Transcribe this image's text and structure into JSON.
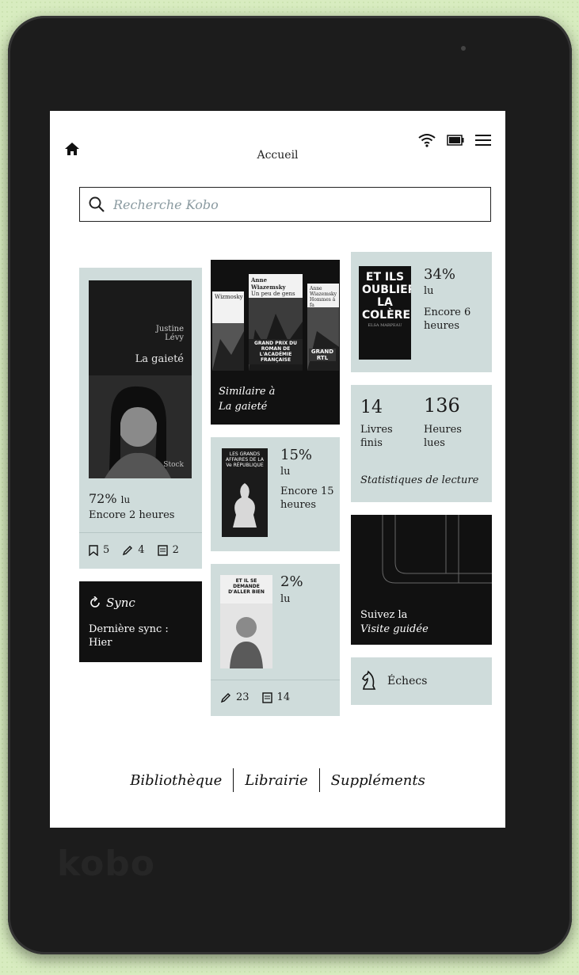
{
  "brand": "kobo",
  "header": {
    "title": "Accueil"
  },
  "search": {
    "placeholder": "Recherche Kobo"
  },
  "book1": {
    "author": "Justine Lévy",
    "cover_title": "La gaieté",
    "publisher": "Stock",
    "progress": "72%",
    "progress_suffix": "lu",
    "remaining": "Encore 2 heures",
    "bookmarks": "5",
    "highlights": "4",
    "notes": "2"
  },
  "similar": {
    "line1": "Similaire à",
    "line2": "La gaieté",
    "covers": [
      {
        "author": "Wizmosky",
        "title": ""
      },
      {
        "author": "Anne Wiazemsky",
        "title": "Un peu de gens",
        "badge": "GRAND PRIX DU ROMAN DE L'ACADÉMIE FRANÇAISE"
      },
      {
        "author": "Anne Wiazemsky",
        "title": "Hommes à fa",
        "badge": "GRAND RTL"
      }
    ]
  },
  "book2": {
    "cover_title": "LES GRANDS AFFAIRES DE LA Ve RÉPUBLIQUE",
    "progress": "15%",
    "progress_suffix": "lu",
    "remaining": "Encore 15 heures"
  },
  "book3": {
    "cover_title": "ET IL SE DEMANDE D'ALLER BIEN",
    "progress": "2%",
    "progress_suffix": "lu",
    "highlights": "23",
    "notes": "14"
  },
  "book4": {
    "cover_title": "ET ILS OUBLIERONT LA COLÈRE",
    "cover_author": "ELSA MARPEAU",
    "progress": "34%",
    "progress_suffix": "lu",
    "remaining": "Encore 6 heures"
  },
  "stats": {
    "books_count": "14",
    "books_label": "Livres finis",
    "hours_count": "136",
    "hours_label": "Heures lues",
    "caption": "Statistiques de lecture"
  },
  "sync": {
    "label": "Sync",
    "last": "Dernière sync :",
    "when": "Hier"
  },
  "tour": {
    "line1": "Suivez la",
    "line2": "Visite guidée"
  },
  "chess": {
    "label": "Échecs"
  },
  "nav": {
    "library": "Bibliothèque",
    "store": "Librairie",
    "extras": "Suppléments"
  }
}
